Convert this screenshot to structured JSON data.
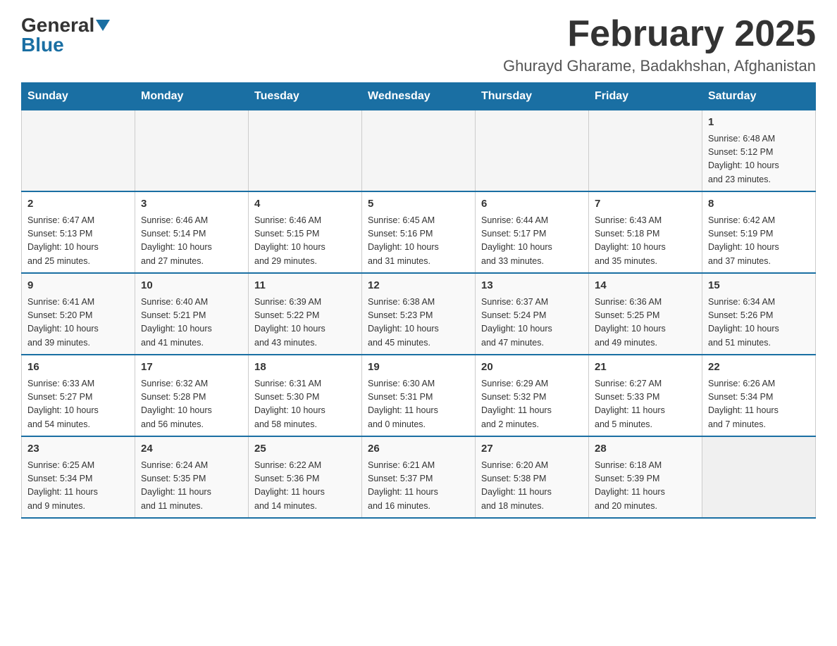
{
  "header": {
    "logo_general": "General",
    "logo_blue": "Blue",
    "month_title": "February 2025",
    "location": "Ghurayd Gharame, Badakhshan, Afghanistan"
  },
  "weekdays": [
    "Sunday",
    "Monday",
    "Tuesday",
    "Wednesday",
    "Thursday",
    "Friday",
    "Saturday"
  ],
  "weeks": [
    [
      {
        "day": "",
        "info": ""
      },
      {
        "day": "",
        "info": ""
      },
      {
        "day": "",
        "info": ""
      },
      {
        "day": "",
        "info": ""
      },
      {
        "day": "",
        "info": ""
      },
      {
        "day": "",
        "info": ""
      },
      {
        "day": "1",
        "info": "Sunrise: 6:48 AM\nSunset: 5:12 PM\nDaylight: 10 hours\nand 23 minutes."
      }
    ],
    [
      {
        "day": "2",
        "info": "Sunrise: 6:47 AM\nSunset: 5:13 PM\nDaylight: 10 hours\nand 25 minutes."
      },
      {
        "day": "3",
        "info": "Sunrise: 6:46 AM\nSunset: 5:14 PM\nDaylight: 10 hours\nand 27 minutes."
      },
      {
        "day": "4",
        "info": "Sunrise: 6:46 AM\nSunset: 5:15 PM\nDaylight: 10 hours\nand 29 minutes."
      },
      {
        "day": "5",
        "info": "Sunrise: 6:45 AM\nSunset: 5:16 PM\nDaylight: 10 hours\nand 31 minutes."
      },
      {
        "day": "6",
        "info": "Sunrise: 6:44 AM\nSunset: 5:17 PM\nDaylight: 10 hours\nand 33 minutes."
      },
      {
        "day": "7",
        "info": "Sunrise: 6:43 AM\nSunset: 5:18 PM\nDaylight: 10 hours\nand 35 minutes."
      },
      {
        "day": "8",
        "info": "Sunrise: 6:42 AM\nSunset: 5:19 PM\nDaylight: 10 hours\nand 37 minutes."
      }
    ],
    [
      {
        "day": "9",
        "info": "Sunrise: 6:41 AM\nSunset: 5:20 PM\nDaylight: 10 hours\nand 39 minutes."
      },
      {
        "day": "10",
        "info": "Sunrise: 6:40 AM\nSunset: 5:21 PM\nDaylight: 10 hours\nand 41 minutes."
      },
      {
        "day": "11",
        "info": "Sunrise: 6:39 AM\nSunset: 5:22 PM\nDaylight: 10 hours\nand 43 minutes."
      },
      {
        "day": "12",
        "info": "Sunrise: 6:38 AM\nSunset: 5:23 PM\nDaylight: 10 hours\nand 45 minutes."
      },
      {
        "day": "13",
        "info": "Sunrise: 6:37 AM\nSunset: 5:24 PM\nDaylight: 10 hours\nand 47 minutes."
      },
      {
        "day": "14",
        "info": "Sunrise: 6:36 AM\nSunset: 5:25 PM\nDaylight: 10 hours\nand 49 minutes."
      },
      {
        "day": "15",
        "info": "Sunrise: 6:34 AM\nSunset: 5:26 PM\nDaylight: 10 hours\nand 51 minutes."
      }
    ],
    [
      {
        "day": "16",
        "info": "Sunrise: 6:33 AM\nSunset: 5:27 PM\nDaylight: 10 hours\nand 54 minutes."
      },
      {
        "day": "17",
        "info": "Sunrise: 6:32 AM\nSunset: 5:28 PM\nDaylight: 10 hours\nand 56 minutes."
      },
      {
        "day": "18",
        "info": "Sunrise: 6:31 AM\nSunset: 5:30 PM\nDaylight: 10 hours\nand 58 minutes."
      },
      {
        "day": "19",
        "info": "Sunrise: 6:30 AM\nSunset: 5:31 PM\nDaylight: 11 hours\nand 0 minutes."
      },
      {
        "day": "20",
        "info": "Sunrise: 6:29 AM\nSunset: 5:32 PM\nDaylight: 11 hours\nand 2 minutes."
      },
      {
        "day": "21",
        "info": "Sunrise: 6:27 AM\nSunset: 5:33 PM\nDaylight: 11 hours\nand 5 minutes."
      },
      {
        "day": "22",
        "info": "Sunrise: 6:26 AM\nSunset: 5:34 PM\nDaylight: 11 hours\nand 7 minutes."
      }
    ],
    [
      {
        "day": "23",
        "info": "Sunrise: 6:25 AM\nSunset: 5:34 PM\nDaylight: 11 hours\nand 9 minutes."
      },
      {
        "day": "24",
        "info": "Sunrise: 6:24 AM\nSunset: 5:35 PM\nDaylight: 11 hours\nand 11 minutes."
      },
      {
        "day": "25",
        "info": "Sunrise: 6:22 AM\nSunset: 5:36 PM\nDaylight: 11 hours\nand 14 minutes."
      },
      {
        "day": "26",
        "info": "Sunrise: 6:21 AM\nSunset: 5:37 PM\nDaylight: 11 hours\nand 16 minutes."
      },
      {
        "day": "27",
        "info": "Sunrise: 6:20 AM\nSunset: 5:38 PM\nDaylight: 11 hours\nand 18 minutes."
      },
      {
        "day": "28",
        "info": "Sunrise: 6:18 AM\nSunset: 5:39 PM\nDaylight: 11 hours\nand 20 minutes."
      },
      {
        "day": "",
        "info": ""
      }
    ]
  ]
}
